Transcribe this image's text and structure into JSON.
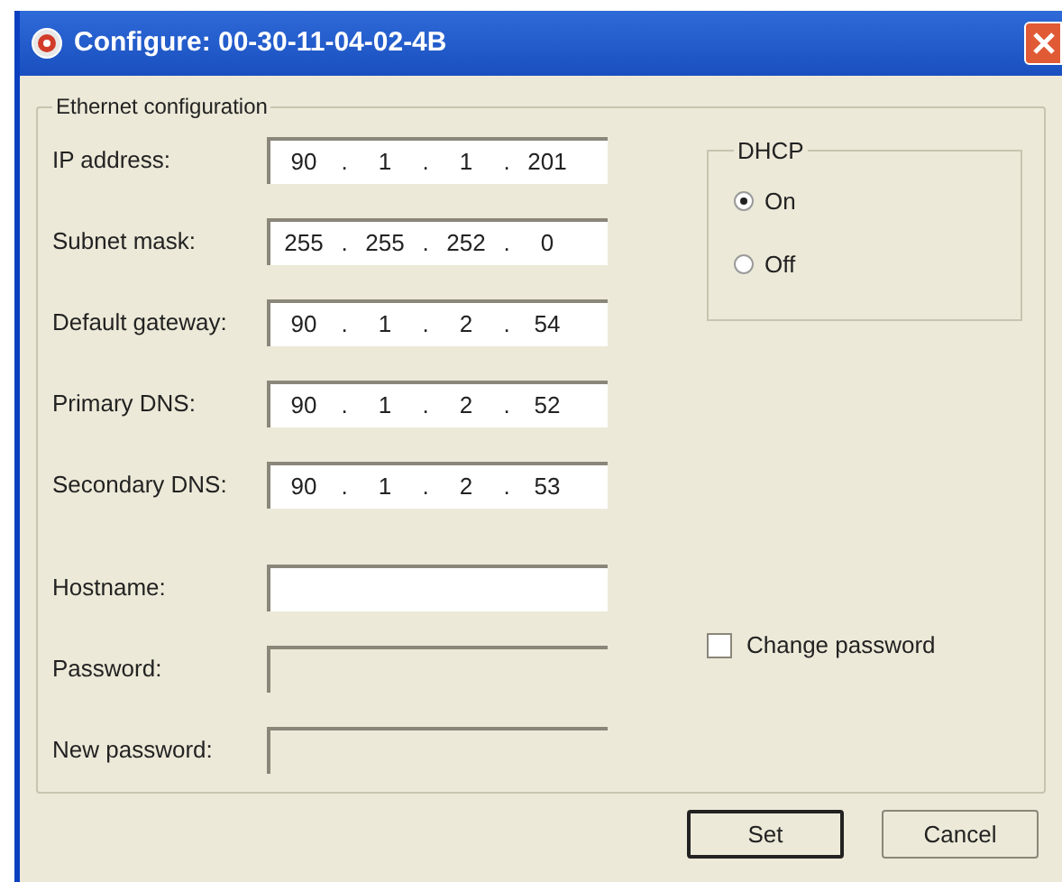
{
  "window": {
    "title": "Configure: 00-30-11-04-02-4B"
  },
  "ethernet": {
    "legend": "Ethernet configuration",
    "addresses": [
      {
        "label": "IP address:",
        "octets": [
          "90",
          "1",
          "1",
          "201"
        ]
      },
      {
        "label": "Subnet mask:",
        "octets": [
          "255",
          "255",
          "252",
          "0"
        ]
      },
      {
        "label": "Default gateway:",
        "octets": [
          "90",
          "1",
          "2",
          "54"
        ]
      },
      {
        "label": "Primary DNS:",
        "octets": [
          "90",
          "1",
          "2",
          "52"
        ]
      },
      {
        "label": "Secondary DNS:",
        "octets": [
          "90",
          "1",
          "2",
          "53"
        ]
      }
    ],
    "accounts": [
      {
        "label": "Hostname:",
        "disabled": false
      },
      {
        "label": "Password:",
        "disabled": true
      },
      {
        "label": "New password:",
        "disabled": true
      }
    ],
    "separator": ".",
    "dhcp": {
      "legend": "DHCP",
      "options": [
        {
          "label": "On",
          "selected": true
        },
        {
          "label": "Off",
          "selected": false
        }
      ]
    },
    "change_password": {
      "label": "Change password",
      "checked": false
    }
  },
  "buttons": [
    {
      "label": "Set",
      "default": true
    },
    {
      "label": "Cancel",
      "default": false
    }
  ]
}
